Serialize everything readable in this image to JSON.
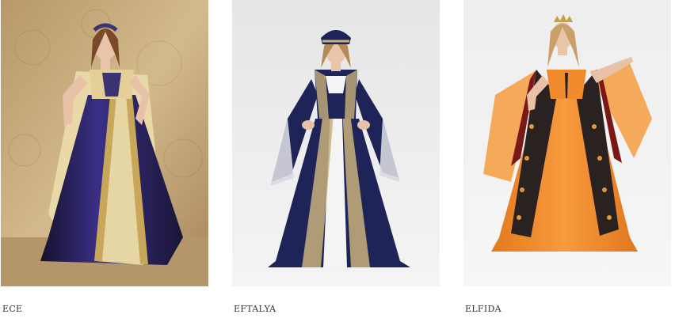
{
  "products": [
    {
      "name": "ECE"
    },
    {
      "name": "EFTALYA"
    },
    {
      "name": "ELFIDA"
    }
  ],
  "colors": {
    "ece_bg": "#c8ac7c",
    "ece_dress": "#2b2456",
    "ece_cape": "#e8d7a6",
    "eftalya_bg": "#eeeeee",
    "eftalya_dress": "#1e2458",
    "eftalya_embroidery": "#c9b07a",
    "elfida_bg": "#f2f2f2",
    "elfida_dress": "#f08a2c",
    "elfida_vest": "#2a2220",
    "elfida_sleeve": "#f5a24a"
  }
}
